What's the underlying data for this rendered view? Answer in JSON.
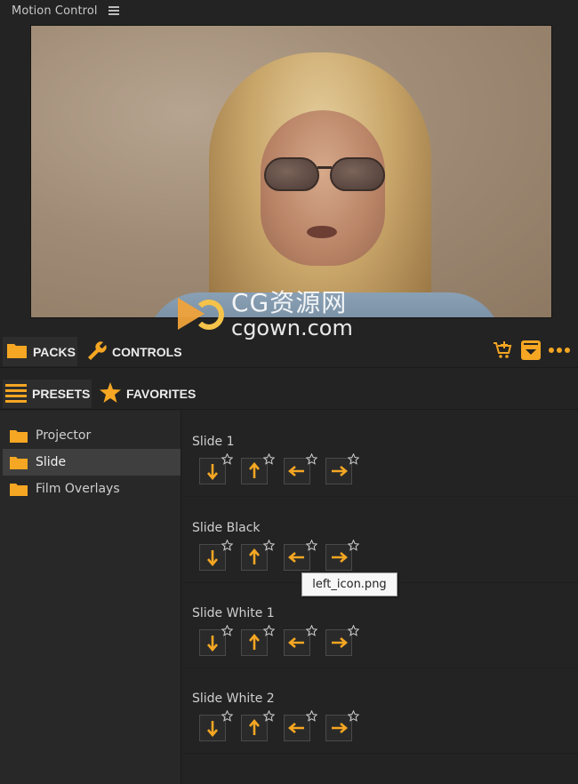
{
  "app": {
    "title": "Motion Control"
  },
  "watermark": {
    "line1": "CG资源网",
    "line2": "cgown.com"
  },
  "tabs": [
    {
      "id": "packs",
      "label": "PACKS",
      "icon": "folder-icon",
      "active": true
    },
    {
      "id": "controls",
      "label": "CONTROLS",
      "icon": "wrench-icon",
      "active": false
    }
  ],
  "actions": [
    "add-to-cart-icon",
    "download-icon",
    "more-icon"
  ],
  "subtabs": [
    {
      "id": "presets",
      "label": "PRESETS",
      "icon": "list-icon",
      "active": true
    },
    {
      "id": "favorites",
      "label": "FAVORITES",
      "icon": "star-icon",
      "active": false
    }
  ],
  "sidebar": {
    "items": [
      {
        "label": "Projector",
        "selected": false
      },
      {
        "label": "Slide",
        "selected": true
      },
      {
        "label": "Film Overlays",
        "selected": false
      }
    ]
  },
  "groups": [
    {
      "name": "Slide 1",
      "presets": [
        "down",
        "up",
        "left",
        "right"
      ]
    },
    {
      "name": "Slide Black",
      "presets": [
        "down",
        "up",
        "left",
        "right"
      ]
    },
    {
      "name": "Slide White 1",
      "presets": [
        "down",
        "up",
        "left",
        "right"
      ]
    },
    {
      "name": "Slide White 2",
      "presets": [
        "down",
        "up",
        "left",
        "right"
      ]
    }
  ],
  "tooltip": {
    "text": "left_icon.png"
  },
  "colors": {
    "accent": "#f5a623",
    "background": "#232323",
    "panel": "#282828",
    "selected": "#3f3f3f"
  }
}
